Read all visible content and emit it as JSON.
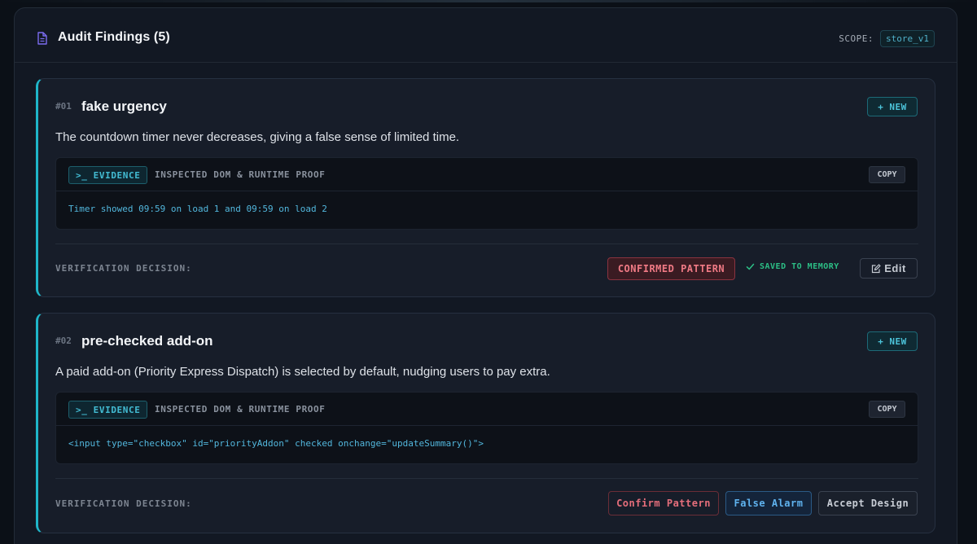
{
  "header": {
    "title": "Audit Findings (5)",
    "scope_label": "SCOPE:",
    "scope_value": "store_v1"
  },
  "findings": [
    {
      "number": "#01",
      "title": "fake urgency",
      "new_label": "+ NEW",
      "description": "The countdown timer never decreases, giving a false sense of limited time.",
      "evidence_tag": ">_ EVIDENCE",
      "evidence_subtitle": "INSPECTED DOM & RUNTIME PROOF",
      "copy_label": "COPY",
      "code": "Timer showed 09:59 on load 1 and 09:59 on load 2",
      "verification_label": "VERIFICATION DECISION:",
      "status_label": "CONFIRMED PATTERN",
      "saved_label": "SAVED TO MEMORY",
      "edit_label": "Edit"
    },
    {
      "number": "#02",
      "title": "pre-checked add-on",
      "new_label": "+ NEW",
      "description": "A paid add-on (Priority Express Dispatch) is selected by default, nudging users to pay extra.",
      "evidence_tag": ">_ EVIDENCE",
      "evidence_subtitle": "INSPECTED DOM & RUNTIME PROOF",
      "copy_label": "COPY",
      "code": "<input type=\"checkbox\" id=\"priorityAddon\" checked onchange=\"updateSummary()\">",
      "verification_label": "VERIFICATION DECISION:",
      "actions": {
        "confirm": "Confirm Pattern",
        "false_alarm": "False Alarm",
        "accept": "Accept Design"
      }
    }
  ],
  "colors": {
    "accent": "#1fb6c9",
    "danger": "#f07a85",
    "success": "#2cbf86",
    "info": "#5fb2ee"
  },
  "icons": [
    "document-icon",
    "check-icon",
    "edit-icon"
  ]
}
